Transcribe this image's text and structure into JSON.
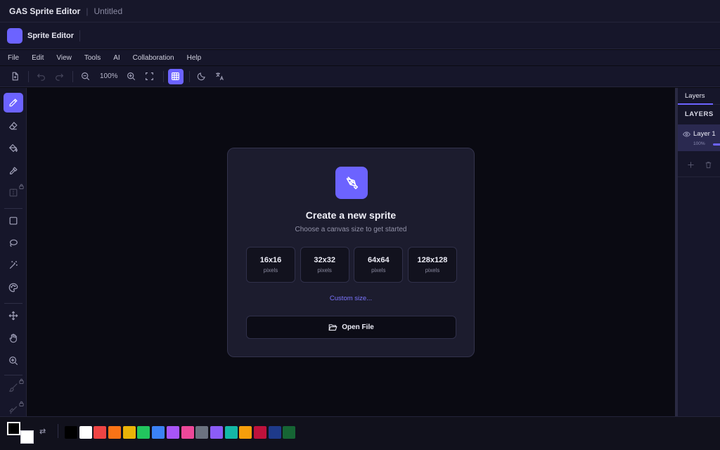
{
  "titlebar": {
    "app_name": "GAS Sprite Editor",
    "separator": "|",
    "document_name": "Untitled"
  },
  "appbar": {
    "name": "Sprite Editor"
  },
  "menu": [
    "File",
    "Edit",
    "View",
    "Tools",
    "AI",
    "Collaboration",
    "Help"
  ],
  "toolbar": {
    "zoom": "100%"
  },
  "dialog": {
    "title": "Create a new sprite",
    "subtitle": "Choose a canvas size to get started",
    "presets": [
      {
        "size": "16x16",
        "unit": "pixels"
      },
      {
        "size": "32x32",
        "unit": "pixels"
      },
      {
        "size": "64x64",
        "unit": "pixels"
      },
      {
        "size": "128x128",
        "unit": "pixels"
      }
    ],
    "custom_link": "Custom size...",
    "open_file": "Open File"
  },
  "panel": {
    "tab": "Layers",
    "header": "LAYERS",
    "layer": {
      "name": "Layer 1",
      "opacity": "100%"
    }
  },
  "colors": {
    "accent": "#6c63ff",
    "foreground": "#000000",
    "background": "#ffffff",
    "palette": [
      "#000000",
      "#ffffff",
      "#ef4444",
      "#f97316",
      "#eab308",
      "#22c55e",
      "#3b82f6",
      "#a855f7",
      "#ec4899",
      "#6b7280",
      "#8b5cf6",
      "#14b8a6",
      "#f59e0b",
      "#be123c",
      "#1e3a8a",
      "#166534"
    ]
  }
}
